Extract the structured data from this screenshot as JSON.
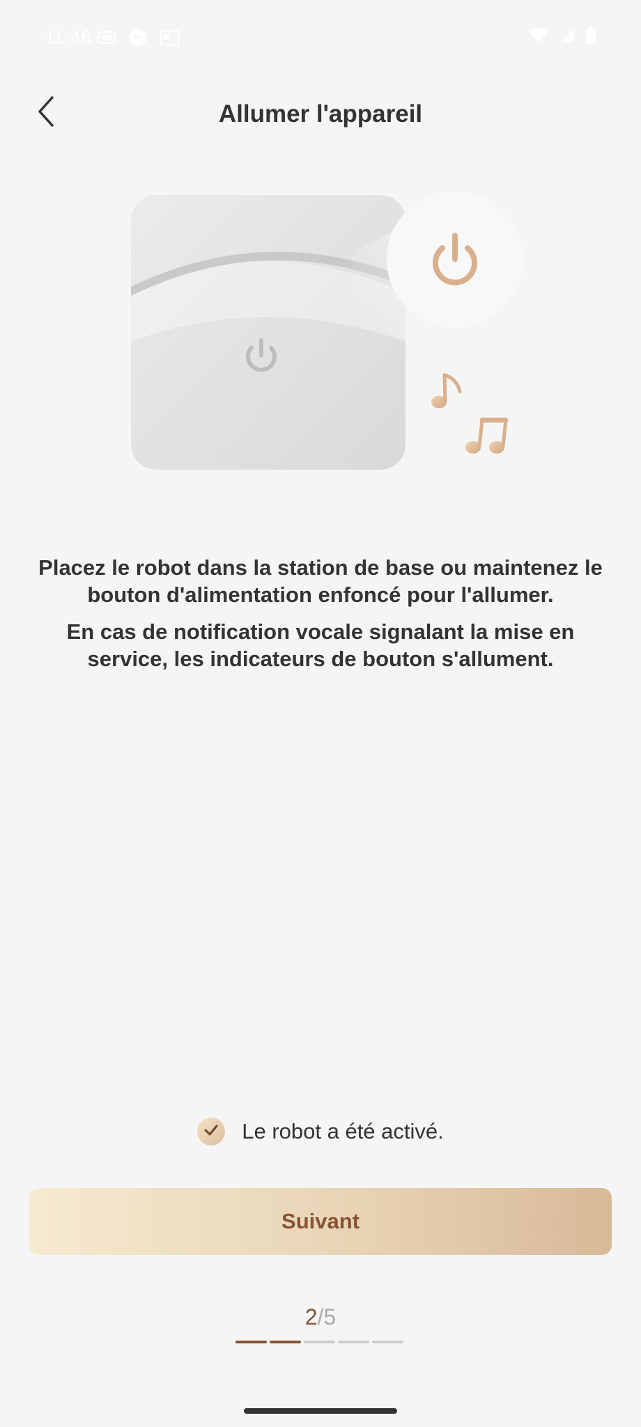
{
  "status_bar": {
    "time": "11:46",
    "left_icons": [
      "data-saver-icon",
      "message-icon",
      "sim-card-icon"
    ],
    "right_icons": [
      "wifi-icon",
      "cellular-signal-icon",
      "battery-icon"
    ]
  },
  "header": {
    "title": "Allumer l'appareil",
    "back_icon": "chevron-left-icon"
  },
  "illustration": {
    "icons": [
      "robot-body",
      "power-icon",
      "power-highlight-icon",
      "music-note-icon",
      "double-music-note-icon"
    ],
    "accent_color": "#d8b08e"
  },
  "instructions": {
    "line1": "Placez le robot dans la station de base ou maintenez le bouton d'alimentation enfoncé pour l'allumer.",
    "line2": "En cas de notification vocale signalant la mise en service, les indicateurs de bouton s'allument."
  },
  "confirm": {
    "label": "Le robot a été activé.",
    "checked": true,
    "check_icon": "checkmark-icon"
  },
  "next_button": {
    "label": "Suivant"
  },
  "progress": {
    "current": "2",
    "separator": "/",
    "total": "5",
    "completed_segments": 2,
    "total_segments": 5,
    "active_color": "#875234"
  },
  "colors": {
    "background": "#f5f5f5",
    "text": "#333333",
    "brand_brown": "#875234",
    "button_gradient_start": "#f6ead0",
    "button_gradient_end": "#d8b998"
  }
}
